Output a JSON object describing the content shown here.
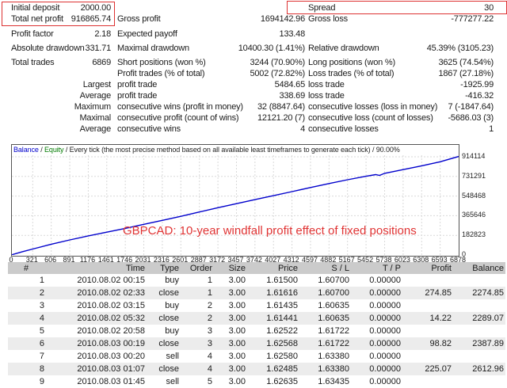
{
  "stats": {
    "rows": [
      {
        "al": "Initial deposit",
        "av": "2000.00",
        "bl": "",
        "bv": "",
        "cl": "Spread",
        "cv": "30"
      },
      {
        "al": "Total net profit",
        "av": "916865.74",
        "bl": "Gross profit",
        "bv": "1694142.96",
        "cl": "Gross loss",
        "cv": "-777277.22"
      },
      {
        "al": "Profit factor",
        "av": "2.18",
        "bl": "Expected payoff",
        "bv": "133.48",
        "cl": "",
        "cv": ""
      },
      {
        "al": "Absolute drawdown",
        "av": "331.71",
        "bl": "Maximal drawdown",
        "bv": "10400.30 (1.41%)",
        "cl": "Relative drawdown",
        "cv": "45.39% (3105.23)"
      },
      {
        "al": "Total trades",
        "av": "6869",
        "bl": "Short positions (won %)",
        "bv": "3244 (70.90%)",
        "cl": "Long positions (won %)",
        "cv": "3625 (74.54%)"
      },
      {
        "al": "",
        "av": "",
        "bl": "Profit trades (% of total)",
        "bv": "5002 (72.82%)",
        "cl": "Loss trades (% of total)",
        "cv": "1867 (27.18%)"
      },
      {
        "al": "",
        "av": "Largest",
        "bl": "profit trade",
        "bv": "5484.65",
        "cl": "loss trade",
        "cv": "-1925.99"
      },
      {
        "al": "",
        "av": "Average",
        "bl": "profit trade",
        "bv": "338.69",
        "cl": "loss trade",
        "cv": "-416.32"
      },
      {
        "al": "",
        "av": "Maximum",
        "bl": "consecutive wins (profit in money)",
        "bv": "32 (8847.64)",
        "cl": "consecutive losses (loss in money)",
        "cv": "7 (-1847.64)"
      },
      {
        "al": "",
        "av": "Maximal",
        "bl": "consecutive profit (count of wins)",
        "bv": "12121.20 (7)",
        "cl": "consecutive loss (count of losses)",
        "cv": "-5686.03 (3)"
      },
      {
        "al": "",
        "av": "Average",
        "bl": "consecutive wins",
        "bv": "4",
        "cl": "consecutive losses",
        "cv": "1"
      }
    ]
  },
  "chart_header": {
    "balance": "Balance",
    "sep1": " / ",
    "equity": "Equity",
    "sep2": " / ",
    "method": "Every tick (the most precise method based on all available least timeframes to generate each tick) / 90.00%"
  },
  "chart_data": {
    "type": "line",
    "title": "Balance / Equity / Every tick (the most precise method based on all available least timeframes to generate each tick) / 90.00%",
    "legend_entries": [
      "Balance",
      "Equity"
    ],
    "grid": true,
    "xlabel": "",
    "ylabel": "",
    "xlim": [
      0,
      6878
    ],
    "ylim": [
      0,
      930000
    ],
    "x_ticks": [
      0,
      321,
      606,
      891,
      1176,
      1461,
      1746,
      2031,
      2316,
      2601,
      2887,
      3172,
      3457,
      3742,
      4027,
      4312,
      4597,
      4882,
      5167,
      5452,
      5738,
      6023,
      6308,
      6593,
      6878
    ],
    "y_ticks": [
      0,
      182823,
      365646,
      548468,
      731291,
      914114
    ],
    "series": [
      {
        "name": "Balance",
        "color": "#0000cc",
        "x": [
          0,
          160,
          321,
          606,
          891,
          1176,
          1461,
          1746,
          2031,
          2316,
          2601,
          2887,
          3172,
          3457,
          3742,
          4027,
          4312,
          4597,
          4882,
          5167,
          5452,
          5600,
          5660,
          5738,
          6023,
          6308,
          6593,
          6878
        ],
        "y": [
          2000,
          30000,
          55000,
          100000,
          140000,
          178000,
          212000,
          248000,
          285000,
          322000,
          360000,
          400000,
          440000,
          478000,
          515000,
          552000,
          590000,
          628000,
          665000,
          700000,
          733000,
          748000,
          741000,
          760000,
          795000,
          830000,
          868000,
          916866
        ]
      }
    ],
    "annotation": {
      "text": "GBPCAD: 10-year windfall profit effect of fixed positions",
      "color": "#e03434"
    }
  },
  "trades": {
    "columns": [
      "#",
      "Time",
      "Type",
      "Order",
      "Size",
      "Price",
      "S / L",
      "T / P",
      "Profit",
      "Balance"
    ],
    "rows": [
      [
        "1",
        "2010.08.02 00:15",
        "buy",
        "1",
        "3.00",
        "1.61500",
        "1.60700",
        "0.00000",
        "",
        ""
      ],
      [
        "2",
        "2010.08.02 02:33",
        "close",
        "1",
        "3.00",
        "1.61616",
        "1.60700",
        "0.00000",
        "274.85",
        "2274.85"
      ],
      [
        "3",
        "2010.08.02 03:15",
        "buy",
        "2",
        "3.00",
        "1.61435",
        "1.60635",
        "0.00000",
        "",
        ""
      ],
      [
        "4",
        "2010.08.02 05:32",
        "close",
        "2",
        "3.00",
        "1.61441",
        "1.60635",
        "0.00000",
        "14.22",
        "2289.07"
      ],
      [
        "5",
        "2010.08.02 20:58",
        "buy",
        "3",
        "3.00",
        "1.62522",
        "1.61722",
        "0.00000",
        "",
        ""
      ],
      [
        "6",
        "2010.08.03 00:19",
        "close",
        "3",
        "3.00",
        "1.62568",
        "1.61722",
        "0.00000",
        "98.82",
        "2387.89"
      ],
      [
        "7",
        "2010.08.03 00:20",
        "sell",
        "4",
        "3.00",
        "1.62580",
        "1.63380",
        "0.00000",
        "",
        ""
      ],
      [
        "8",
        "2010.08.03 01:07",
        "close",
        "4",
        "3.00",
        "1.62485",
        "1.63380",
        "0.00000",
        "225.07",
        "2612.96"
      ],
      [
        "9",
        "2010.08.03 01:45",
        "sell",
        "5",
        "3.00",
        "1.62635",
        "1.63435",
        "0.00000",
        "",
        ""
      ]
    ]
  },
  "colors": {
    "highlight_red": "#dd3232",
    "balance_line": "#0000cc",
    "equity_legend": "#007a00",
    "table_header_bg": "#cbcbcb",
    "table_alt_row_bg": "#ececec",
    "grid_line": "#d9d9d9"
  }
}
